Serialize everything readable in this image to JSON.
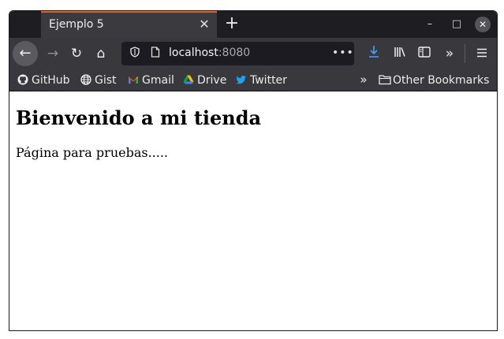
{
  "tab": {
    "title": "Ejemplo 5",
    "close_glyph": "✕"
  },
  "new_tab_glyph": "+",
  "window_controls": {
    "minimize": "–",
    "maximize": "□",
    "close": "✕"
  },
  "nav": {
    "back_glyph": "←",
    "forward_glyph": "→",
    "reload_glyph": "↻",
    "home_glyph": "⌂"
  },
  "url": {
    "host": "localhost",
    "port": ":8080",
    "more_glyph": "•••"
  },
  "toolbar": {
    "download_glyph": "⭳",
    "library_glyph": "|||\\",
    "sidebar_glyph": "◫",
    "overflow_glyph": "»",
    "menu_glyph": "≡"
  },
  "bookmarks": {
    "items": [
      {
        "label": "GitHub",
        "icon": "github-icon"
      },
      {
        "label": "Gist",
        "icon": "globe-icon"
      },
      {
        "label": "Gmail",
        "icon": "gmail-icon"
      },
      {
        "label": "Drive",
        "icon": "drive-icon"
      },
      {
        "label": "Twitter",
        "icon": "twitter-icon"
      }
    ],
    "overflow_glyph": "»",
    "other": "Other Bookmarks"
  },
  "page": {
    "heading": "Bienvenido a mi tienda",
    "paragraph": "Página para pruebas....."
  },
  "colors": {
    "tab_accent": "#e66327",
    "download": "#45a1ff",
    "toolbar_bg": "#38383d",
    "tabstrip_bg": "#1e1e22"
  }
}
